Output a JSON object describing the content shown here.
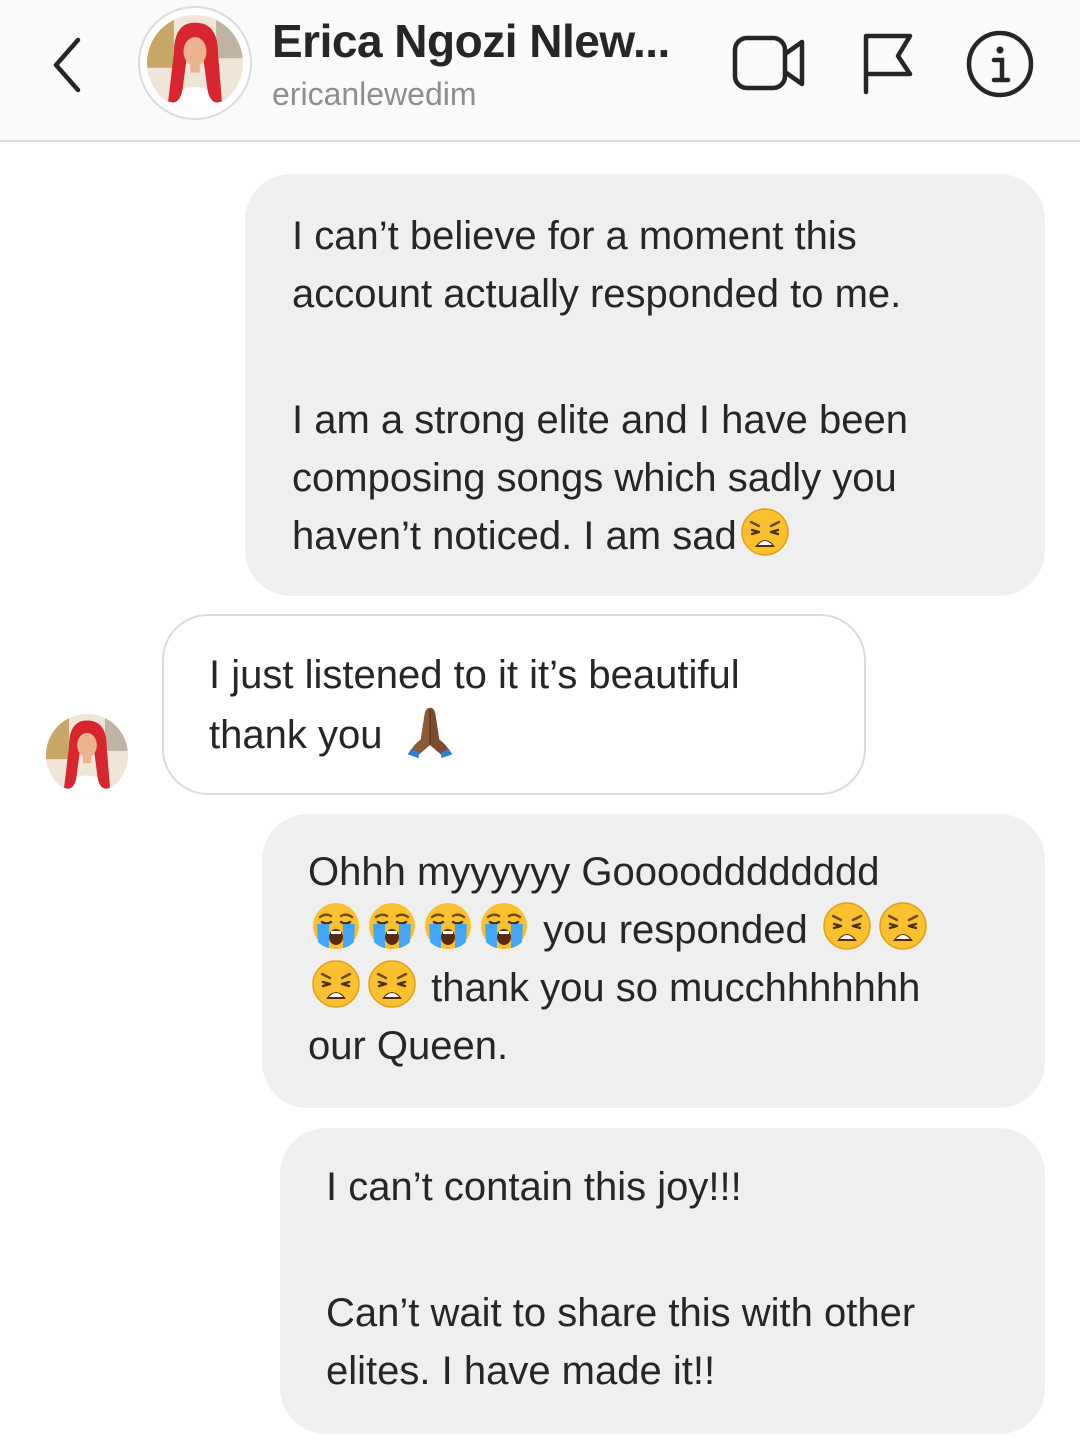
{
  "header": {
    "display_name": "Erica Ngozi Nlew...",
    "username": "ericanlewedim",
    "back_icon": "chevron-left-icon",
    "actions": [
      "video-call-icon",
      "report-flag-icon",
      "info-icon"
    ]
  },
  "messages": [
    {
      "direction": "outgoing",
      "paragraphs": [
        [
          "I can’t believe for a moment this",
          "account actually responded to me."
        ],
        [
          "I am a strong elite and I have been",
          "composing songs which sadly you",
          "haven’t noticed. I am sad"
        ]
      ]
    },
    {
      "direction": "incoming",
      "lines": [
        "I just listened to it it’s beautiful",
        "thank you"
      ]
    },
    {
      "direction": "outgoing",
      "lines": [
        "Ohhh myyyyyy Goooodddddddd",
        "you responded",
        "thank you so mucchhhhhhh",
        "our Queen."
      ]
    },
    {
      "direction": "outgoing",
      "paragraphs": [
        [
          "I can’t contain this joy!!!"
        ],
        [
          "Can’t wait to share this with other",
          "elites. I have made it!!"
        ]
      ]
    }
  ],
  "colors": {
    "outgoing_bubble": "#efefef",
    "incoming_border": "#dbdbdb",
    "header_bg": "#fafafa",
    "secondary_text": "#8e8e8e",
    "avatar_hair": "#d8262e"
  }
}
